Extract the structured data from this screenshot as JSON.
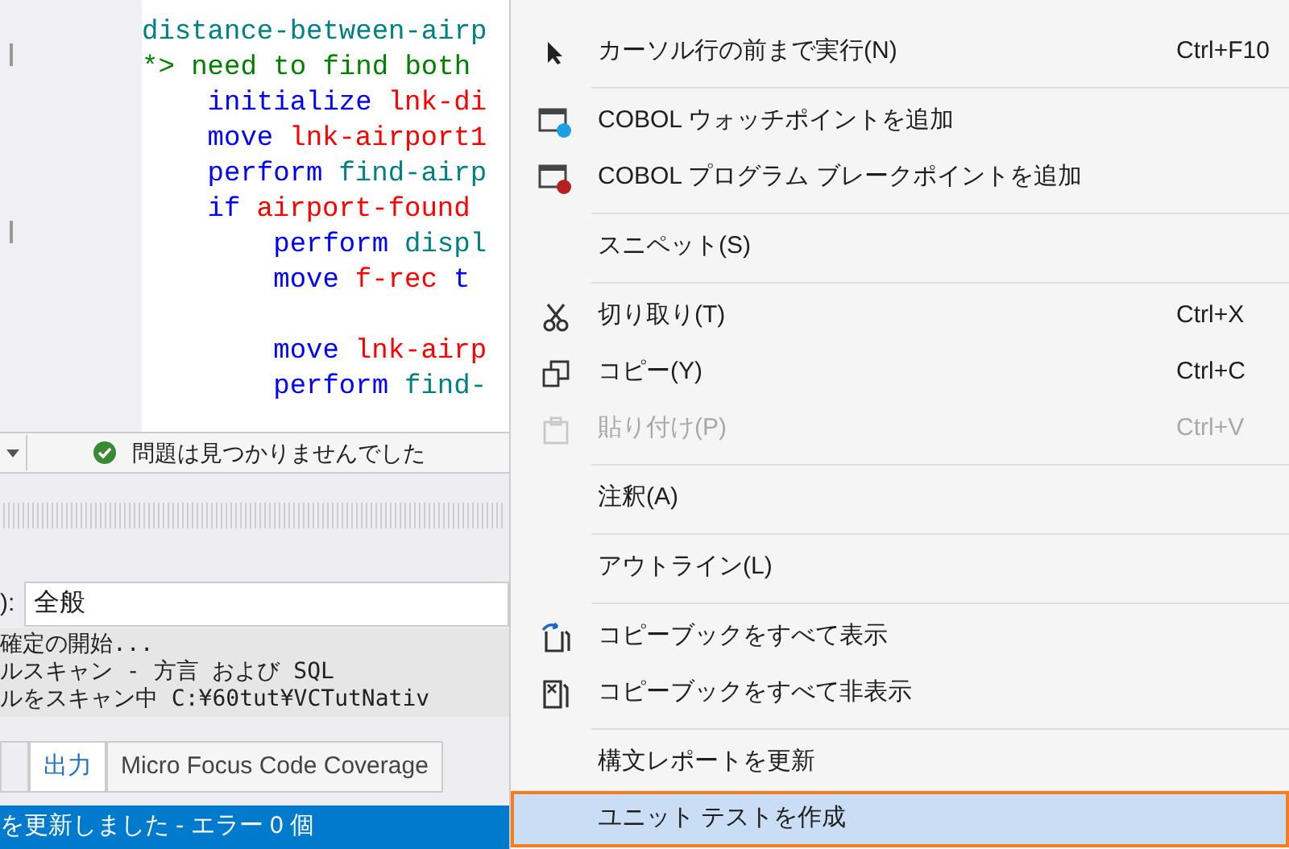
{
  "editor": {
    "lines": [
      {
        "kind": "code",
        "tokens": [
          {
            "kind": "paragraph",
            "text": "distance-between-airp"
          }
        ]
      },
      {
        "kind": "code",
        "tokens": [
          {
            "kind": "comment",
            "text": "*> need to find both"
          }
        ]
      },
      {
        "kind": "code",
        "tokens": [
          {
            "kind": "keyword",
            "text": "    initialize"
          },
          {
            "kind": "variable",
            "text": "lnk-di"
          }
        ]
      },
      {
        "kind": "code",
        "tokens": [
          {
            "kind": "keyword",
            "text": "    move"
          },
          {
            "kind": "variable",
            "text": "lnk-airport1"
          }
        ]
      },
      {
        "kind": "code",
        "tokens": [
          {
            "kind": "keyword",
            "text": "    perform"
          },
          {
            "kind": "paragraph",
            "text": "find-airp"
          }
        ]
      },
      {
        "kind": "code",
        "tokens": [
          {
            "kind": "keyword",
            "text": "    if"
          },
          {
            "kind": "variable",
            "text": "airport-found"
          }
        ]
      },
      {
        "kind": "code",
        "tokens": [
          {
            "kind": "keyword",
            "text": "        perform"
          },
          {
            "kind": "paragraph",
            "text": "displ"
          }
        ]
      },
      {
        "kind": "code",
        "tokens": [
          {
            "kind": "keyword",
            "text": "        move"
          },
          {
            "kind": "variable",
            "text": "f-rec"
          },
          {
            "kind": "keyword",
            "text": "t"
          }
        ]
      },
      {
        "kind": "blank"
      },
      {
        "kind": "code",
        "tokens": [
          {
            "kind": "keyword",
            "text": "        move"
          },
          {
            "kind": "variable",
            "text": "lnk-airp"
          }
        ]
      },
      {
        "kind": "code",
        "tokens": [
          {
            "kind": "keyword",
            "text": "        perform"
          },
          {
            "kind": "paragraph",
            "text": "find-"
          }
        ]
      }
    ]
  },
  "issues": {
    "text": "問題は見つかりませんでした"
  },
  "output": {
    "source_label": "):",
    "source_value": "全般",
    "lines": [
      "確定の開始...",
      "ルスキャン - 方言 および SQL",
      "ルをスキャン中 C:¥60tut¥VCTutNativ"
    ]
  },
  "panel_tabs": [
    {
      "label": "出力",
      "selected": true
    },
    {
      "label": "Micro Focus Code Coverage",
      "selected": false
    }
  ],
  "status_bar": {
    "text": "を更新しました - エラー 0 個"
  },
  "context_menu": [
    {
      "kind": "item",
      "label": "カーソル行の前まで実行(N)",
      "shortcut": "Ctrl+F10",
      "disabled": false,
      "selected": false
    },
    {
      "kind": "separator"
    },
    {
      "kind": "item",
      "label": "COBOL ウォッチポイントを追加",
      "disabled": false,
      "selected": false
    },
    {
      "kind": "item",
      "label": "COBOL プログラム ブレークポイントを追加",
      "disabled": false,
      "selected": false
    },
    {
      "kind": "separator"
    },
    {
      "kind": "item",
      "label": "スニペット(S)",
      "disabled": false,
      "selected": false
    },
    {
      "kind": "separator"
    },
    {
      "kind": "item",
      "label": "切り取り(T)",
      "shortcut": "Ctrl+X",
      "disabled": false,
      "selected": false
    },
    {
      "kind": "item",
      "label": "コピー(Y)",
      "shortcut": "Ctrl+C",
      "disabled": false,
      "selected": false
    },
    {
      "kind": "item",
      "label": "貼り付け(P)",
      "shortcut": "Ctrl+V",
      "disabled": true,
      "selected": false
    },
    {
      "kind": "separator"
    },
    {
      "kind": "item",
      "label": "注釈(A)",
      "disabled": false,
      "selected": false
    },
    {
      "kind": "separator"
    },
    {
      "kind": "item",
      "label": "アウトライン(L)",
      "disabled": false,
      "selected": false
    },
    {
      "kind": "separator"
    },
    {
      "kind": "item",
      "label": "コピーブックをすべて表示",
      "disabled": false,
      "selected": false
    },
    {
      "kind": "item",
      "label": "コピーブックをすべて非表示",
      "disabled": false,
      "selected": false
    },
    {
      "kind": "separator"
    },
    {
      "kind": "item",
      "label": "構文レポートを更新",
      "disabled": false,
      "selected": false
    },
    {
      "kind": "item",
      "label": "ユニット テストを作成",
      "disabled": false,
      "selected": true
    }
  ]
}
